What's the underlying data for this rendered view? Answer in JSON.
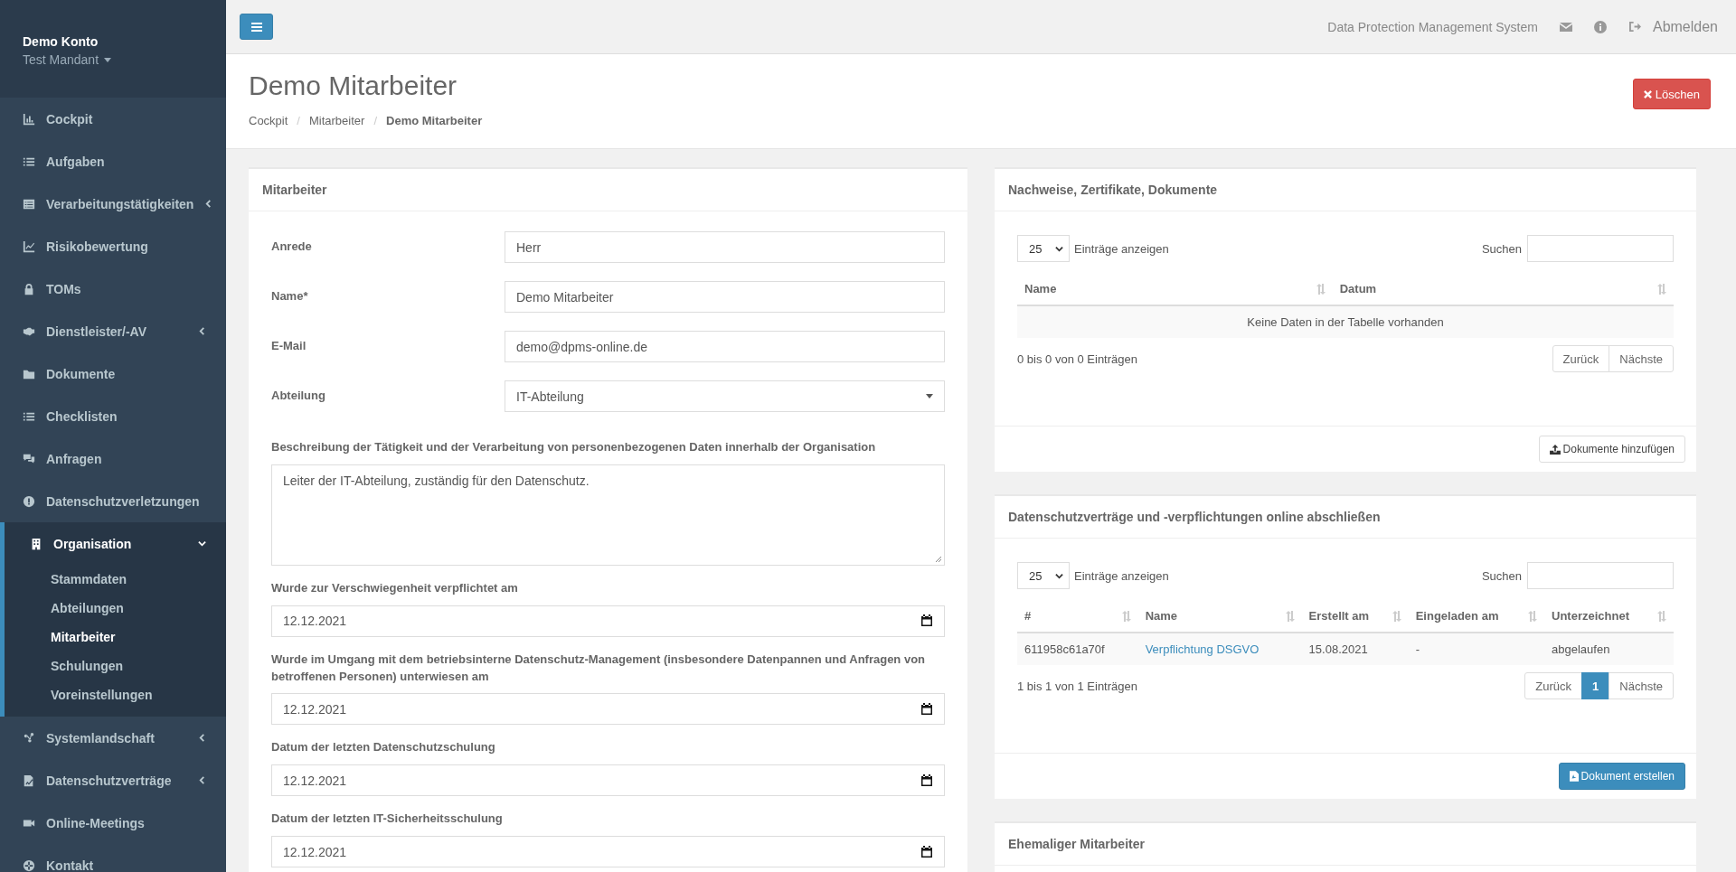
{
  "sidebar": {
    "account": "Demo Konto",
    "tenant": "Test Mandant",
    "items": [
      {
        "label": "Cockpit",
        "kind": "link",
        "selected": false
      },
      {
        "label": "Aufgaben",
        "kind": "link",
        "selected": false
      },
      {
        "label": "Verarbeitungstätigkeiten",
        "kind": "group",
        "expanded": false,
        "selected": false
      },
      {
        "label": "Risikobewertung",
        "kind": "link",
        "selected": false
      },
      {
        "label": "TOMs",
        "kind": "link",
        "selected": false
      },
      {
        "label": "Dienstleister/-AV",
        "kind": "group",
        "expanded": false,
        "selected": false
      },
      {
        "label": "Dokumente",
        "kind": "link",
        "selected": false
      },
      {
        "label": "Checklisten",
        "kind": "link",
        "selected": false
      },
      {
        "label": "Anfragen",
        "kind": "link",
        "selected": false
      },
      {
        "label": "Datenschutzverletzungen",
        "kind": "link",
        "selected": false
      },
      {
        "label": "Organisation",
        "kind": "group",
        "expanded": true,
        "selected": true,
        "children": [
          {
            "label": "Stammdaten",
            "selected": false
          },
          {
            "label": "Abteilungen",
            "selected": false
          },
          {
            "label": "Mitarbeiter",
            "selected": true
          },
          {
            "label": "Schulungen",
            "selected": false
          },
          {
            "label": "Voreinstellungen",
            "selected": false
          }
        ]
      },
      {
        "label": "Systemlandschaft",
        "kind": "group",
        "expanded": false,
        "selected": false
      },
      {
        "label": "Datenschutzverträge",
        "kind": "group",
        "expanded": false,
        "selected": false
      },
      {
        "label": "Online-Meetings",
        "kind": "link",
        "selected": false
      },
      {
        "label": "Kontakt",
        "kind": "link",
        "selected": false
      }
    ]
  },
  "topbar": {
    "app_name": "Data Protection Management System",
    "logout": "Abmelden"
  },
  "page": {
    "title": "Demo Mitarbeiter",
    "breadcrumb": [
      "Cockpit",
      "Mitarbeiter",
      "Demo Mitarbeiter"
    ],
    "breadcrumb_separator": "/",
    "delete_button": "Löschen"
  },
  "employee_card": {
    "title": "Mitarbeiter",
    "fields": [
      {
        "kind": "text",
        "label": "Anrede",
        "value": "Herr"
      },
      {
        "kind": "text",
        "label": "Name*",
        "value": "Demo Mitarbeiter"
      },
      {
        "kind": "text",
        "label": "E-Mail",
        "value": "demo@dpms-online.de"
      },
      {
        "kind": "select",
        "label": "Abteilung",
        "value": "IT-Abteilung"
      },
      {
        "kind": "textarea",
        "label": "Beschreibung der Tätigkeit und der Verarbeitung von personenbezogenen Daten innerhalb der Organisation",
        "value": "Leiter der IT-Abteilung, zuständig für den Datenschutz."
      },
      {
        "kind": "date",
        "label": "Wurde zur Verschwiegenheit verpflichtet am",
        "value": "12.12.2021"
      },
      {
        "kind": "date",
        "label": "Wurde im Umgang mit dem betriebsinterne Datenschutz-Management (insbesondere Datenpannen und Anfragen von betroffenen Personen) unterwiesen am",
        "value": "12.12.2021"
      },
      {
        "kind": "date",
        "label": "Datum der letzten Datenschutzschulung",
        "value": "12.12.2021"
      },
      {
        "kind": "date",
        "label": "Datum der letzten IT-Sicherheitsschulung",
        "value": "12.12.2021"
      }
    ]
  },
  "documents_card": {
    "title": "Nachweise, Zertifikate, Dokumente",
    "page_size": "25",
    "length_label": "Einträge anzeigen",
    "search_label": "Suchen",
    "columns": [
      "Name",
      "Datum"
    ],
    "empty_message": "Keine Daten in der Tabelle vorhanden",
    "info": "0 bis 0 von 0 Einträgen",
    "pagination": [
      {
        "label": "Zurück",
        "selected": false
      },
      {
        "label": "Nächste",
        "selected": false
      }
    ],
    "button": "Dokumente hinzufügen"
  },
  "contracts_card": {
    "title": "Datenschutzverträge und -verpflichtungen online abschließen",
    "page_size": "25",
    "length_label": "Einträge anzeigen",
    "search_label": "Suchen",
    "columns": [
      "#",
      "Name",
      "Erstellt am",
      "Eingeladen am",
      "Unterzeichnet"
    ],
    "rows": [
      {
        "id": "611958c61a70f",
        "name": "Verpflichtung DSGVO",
        "created": "15.08.2021",
        "invited": "-",
        "signed": "abgelaufen"
      }
    ],
    "info": "1 bis 1 von 1 Einträgen",
    "pagination": [
      {
        "label": "Zurück",
        "selected": false
      },
      {
        "label": "1",
        "selected": true
      },
      {
        "label": "Nächste",
        "selected": false
      }
    ],
    "button": "Dokument erstellen"
  },
  "former_card": {
    "title": "Ehemaliger Mitarbeiter"
  }
}
